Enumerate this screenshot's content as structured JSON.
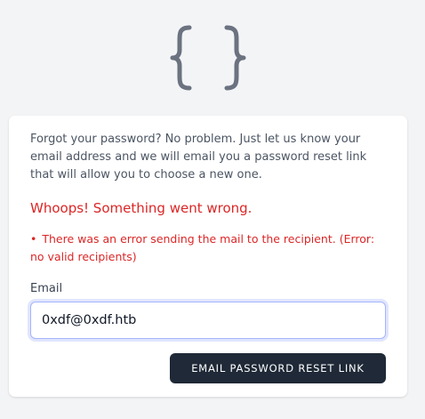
{
  "logo": {
    "icon": "curly-braces-icon",
    "color": "#6b7280"
  },
  "forgot_password": {
    "intro_text": "Forgot your password? No problem. Just let us know your email address and we will email you a password reset link that will allow you to choose a new one.",
    "error_title": "Whoops! Something went wrong.",
    "errors": [
      "There was an error sending the mail to the recipient. (Error: no valid recipients)"
    ],
    "email_label": "Email",
    "email_value": "0xdf@0xdf.htb",
    "submit_label": "EMAIL PASSWORD RESET LINK"
  },
  "colors": {
    "background": "#f3f4f6",
    "error": "#dc2626",
    "button": "#1f2937",
    "input_focus": "#a5b4fc"
  }
}
